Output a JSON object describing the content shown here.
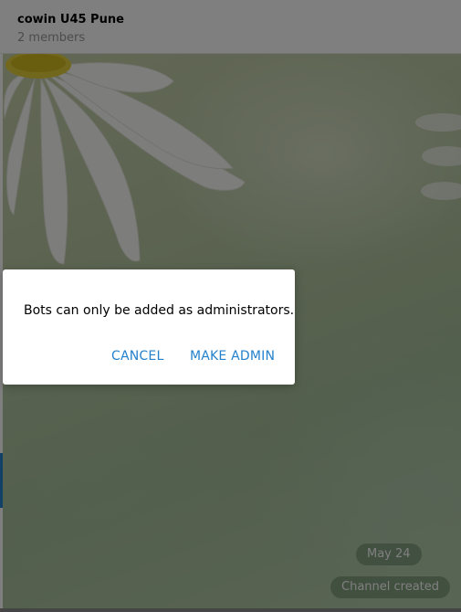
{
  "chat": {
    "title": "cowin U45 Pune",
    "subtitle": "2 members"
  },
  "messages": {
    "date": "May 24",
    "service": "Channel created"
  },
  "dialog": {
    "message": "Bots can only be added as administrators.",
    "cancel_label": "CANCEL",
    "confirm_label": "MAKE ADMIN"
  },
  "colors": {
    "accent": "#2481cc",
    "overlay": "rgba(0,0,0,0.5)"
  }
}
